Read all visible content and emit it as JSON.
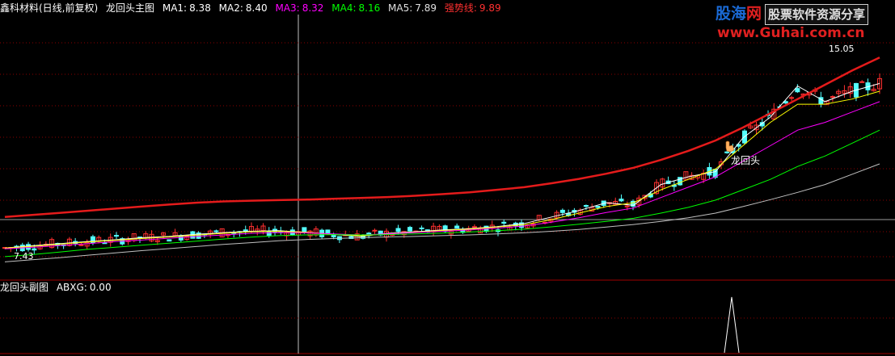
{
  "header": {
    "stock": "鑫科材料(日线,前复权)",
    "indicator_name": "龙回头主图",
    "ma1": {
      "label": "MA1:",
      "value": "8.38",
      "color": "#ffffff"
    },
    "ma2": {
      "label": "MA2:",
      "value": "8.40",
      "color": "#ffff00"
    },
    "ma3": {
      "label": "MA3:",
      "value": "8.32",
      "color": "#ff00ff"
    },
    "ma4": {
      "label": "MA4:",
      "value": "8.16",
      "color": "#00ff00"
    },
    "ma5": {
      "label": "MA5:",
      "value": "7.89",
      "color": "#c0c0c0"
    },
    "trend": {
      "label": "强势线:",
      "value": "9.89",
      "color": "#ff3030"
    }
  },
  "logo": {
    "name_part1": "股海",
    "name_part2": "网",
    "tagline": "股票软件资源分享",
    "url": "www.Guhai.com.cn"
  },
  "subchart": {
    "title": "龙回头副图",
    "abxg_label": "ABXG:",
    "abxg_value": "0.00"
  },
  "chart_data": {
    "type": "candlestick",
    "low_label": "7.43",
    "high_label": "15.05",
    "annotation": "龙回头",
    "colors": {
      "up": "#ff3030",
      "down": "#54ffff",
      "trend": "#e41b1b",
      "ma1": "#ffffff",
      "ma2": "#ffff00",
      "ma3": "#ff00ff",
      "ma4": "#00ff00",
      "ma5": "#c0c0c0",
      "signal": "#ffffff"
    },
    "ma_series": [
      {
        "key": "ma1",
        "values": [
          7.55,
          7.64,
          7.72,
          7.8,
          7.87,
          7.95,
          8.0,
          8.08,
          8.15,
          8.2,
          8.22,
          8.16,
          8.08,
          8.0,
          8.12,
          8.18,
          8.25,
          8.3,
          8.38,
          8.5,
          8.75,
          9.0,
          9.3,
          9.2,
          10.0,
          10.3,
          10.5,
          11.8,
          12.6,
          13.8,
          13.2,
          13.6,
          13.9
        ]
      },
      {
        "key": "ma2",
        "values": [
          7.55,
          7.62,
          7.7,
          7.78,
          7.85,
          7.92,
          7.98,
          8.05,
          8.12,
          8.18,
          8.2,
          8.16,
          8.08,
          8.02,
          8.1,
          8.16,
          8.23,
          8.28,
          8.36,
          8.45,
          8.65,
          8.9,
          9.15,
          9.3,
          9.8,
          10.2,
          10.6,
          11.5,
          12.4,
          13.1,
          13.1,
          13.3,
          13.6
        ]
      },
      {
        "key": "ma3",
        "values": [
          7.52,
          7.58,
          7.65,
          7.72,
          7.8,
          7.86,
          7.93,
          8.0,
          8.06,
          8.12,
          8.15,
          8.14,
          8.1,
          8.06,
          8.1,
          8.15,
          8.2,
          8.25,
          8.32,
          8.4,
          8.55,
          8.72,
          8.92,
          9.1,
          9.5,
          9.9,
          10.3,
          10.9,
          11.5,
          12.1,
          12.4,
          12.8,
          13.2
        ]
      },
      {
        "key": "ma4",
        "values": [
          7.22,
          7.3,
          7.4,
          7.5,
          7.58,
          7.66,
          7.74,
          7.82,
          7.9,
          7.97,
          8.03,
          8.06,
          8.07,
          8.06,
          8.07,
          8.1,
          8.13,
          8.17,
          8.22,
          8.28,
          8.37,
          8.47,
          8.58,
          8.7,
          8.9,
          9.12,
          9.4,
          9.8,
          10.2,
          10.7,
          11.1,
          11.6,
          12.1
        ]
      },
      {
        "key": "ma5",
        "values": [
          7.02,
          7.1,
          7.18,
          7.27,
          7.36,
          7.45,
          7.53,
          7.61,
          7.69,
          7.76,
          7.83,
          7.88,
          7.92,
          7.95,
          7.98,
          8.0,
          8.03,
          8.06,
          8.1,
          8.14,
          8.2,
          8.27,
          8.36,
          8.46,
          8.58,
          8.72,
          8.9,
          9.15,
          9.42,
          9.7,
          10.0,
          10.4,
          10.8
        ]
      }
    ],
    "trend_values": [
      8.75,
      8.83,
      8.91,
      8.99,
      9.07,
      9.15,
      9.23,
      9.3,
      9.35,
      9.38,
      9.4,
      9.42,
      9.45,
      9.48,
      9.52,
      9.57,
      9.63,
      9.7,
      9.8,
      9.9,
      10.05,
      10.22,
      10.42,
      10.65,
      10.95,
      11.3,
      11.7,
      12.2,
      12.75,
      13.3,
      13.85,
      14.4,
      14.9
    ],
    "signal_values": [
      0,
      0,
      0,
      0,
      0,
      0,
      0,
      0,
      0,
      0,
      0,
      0,
      0,
      0,
      0,
      0,
      0,
      0,
      0,
      0,
      0,
      0,
      0,
      0,
      0,
      0,
      0,
      1,
      0,
      0,
      0,
      0,
      0
    ]
  }
}
